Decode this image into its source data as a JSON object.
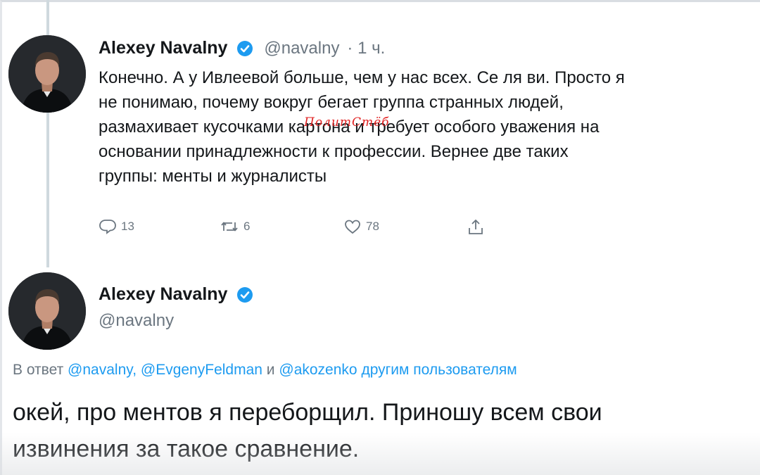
{
  "tweet1": {
    "name": "Alexey Navalny",
    "handle": "@navalny",
    "time": "· 1 ч.",
    "lines": [
      "Конечно. А у Ивлеевой больше, чем у нас всех. Се ля ви. Просто я",
      "не понимаю, почему вокруг бегает группа странных людей,",
      "размахивает кусочками картона и требует особого уважения на",
      "основании принадлежности к профессии. Вернее две таких",
      "группы: менты и журналисты"
    ],
    "replies": "13",
    "retweets": "6",
    "likes": "78"
  },
  "watermark": "ПолитСтёб",
  "tweet2": {
    "name": "Alexey Navalny",
    "handle": "@navalny",
    "reply_prefix": "В ответ",
    "mentions": [
      "@navalny,",
      "@EvgenyFeldman"
    ],
    "reply_and": "и",
    "mention_last": "@akozenko",
    "reply_suffix": "другим пользователям",
    "lines": [
      "окей, про ментов я переборщил. Приношу всем свои",
      "извинения за такое сравнение."
    ]
  },
  "icons": {
    "verified": "verified-badge-icon",
    "reply": "reply-icon",
    "retweet": "retweet-icon",
    "like": "heart-icon",
    "share": "share-icon"
  },
  "colors": {
    "accent": "#1d9bf0",
    "secondary_text": "#6b7680",
    "watermark": "#e02020"
  }
}
